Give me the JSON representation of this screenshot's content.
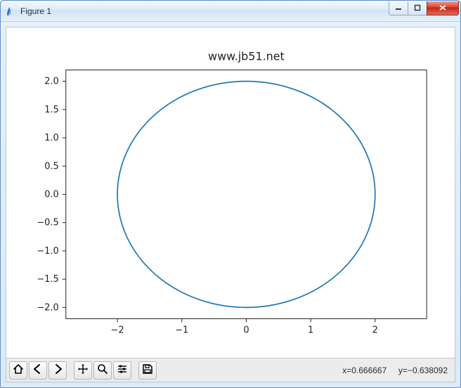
{
  "window": {
    "title": "Figure 1",
    "buttons": {
      "minimize": "minimize",
      "maximize": "maximize",
      "close": "close"
    }
  },
  "chart_data": {
    "type": "line",
    "title": "www.jb51.net",
    "xlabel": "",
    "ylabel": "",
    "xlim": [
      -2.8,
      2.8
    ],
    "ylim": [
      -2.2,
      2.2
    ],
    "x_ticks": [
      -2,
      -1,
      0,
      1,
      2
    ],
    "y_ticks": [
      -2.0,
      -1.5,
      -1.0,
      -0.5,
      0.0,
      0.5,
      1.0,
      1.5,
      2.0
    ],
    "x_tick_labels": [
      "−2",
      "−1",
      "0",
      "1",
      "2"
    ],
    "y_tick_labels": [
      "−2.0",
      "−1.5",
      "−1.0",
      "−0.5",
      "0.0",
      "0.5",
      "1.0",
      "1.5",
      "2.0"
    ],
    "series": [
      {
        "name": "circle",
        "shape": "circle",
        "cx": 0,
        "cy": 0,
        "r": 2,
        "color": "#1f77b4"
      }
    ],
    "grid": false,
    "legend": false
  },
  "toolbar": {
    "buttons": [
      {
        "name": "home-button",
        "icon": "home-icon"
      },
      {
        "name": "back-button",
        "icon": "arrow-left-icon"
      },
      {
        "name": "forward-button",
        "icon": "arrow-right-icon"
      },
      {
        "sep": true
      },
      {
        "name": "pan-button",
        "icon": "move-icon"
      },
      {
        "name": "zoom-button",
        "icon": "magnify-icon"
      },
      {
        "name": "subplots-button",
        "icon": "sliders-icon"
      },
      {
        "sep": true
      },
      {
        "name": "save-button",
        "icon": "save-icon"
      }
    ]
  },
  "status": {
    "coord": "x=0.666667     y=−0.638092"
  },
  "colors": {
    "line": "#1f77b4"
  }
}
